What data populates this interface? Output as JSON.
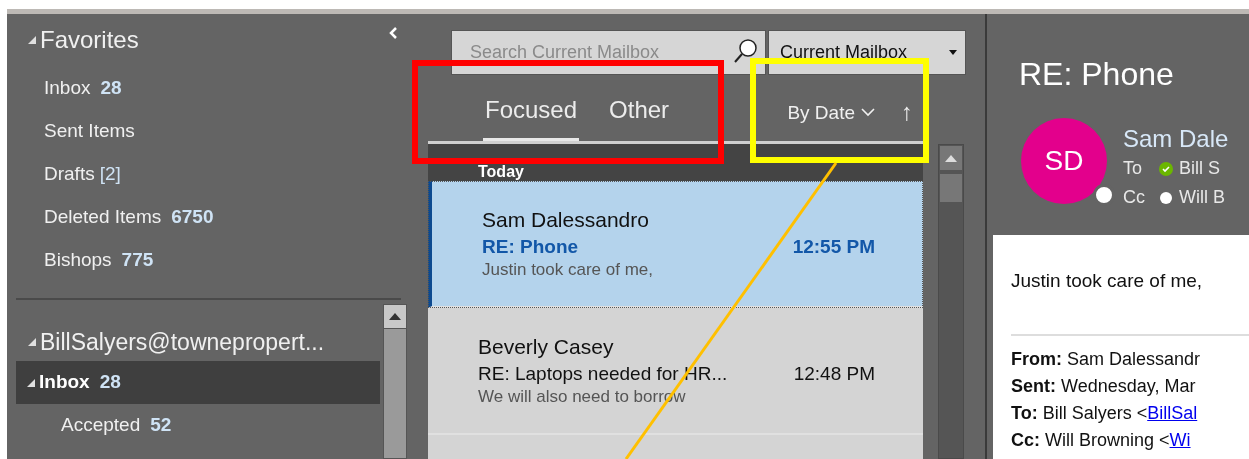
{
  "sidebar": {
    "favorites": {
      "title": "Favorites",
      "expanded": true,
      "items": [
        {
          "label": "Inbox",
          "count": "28",
          "kind": "unread",
          "selected": false
        },
        {
          "label": "Sent Items",
          "kind": "plain",
          "selected": false
        },
        {
          "label": "Drafts",
          "count": "[2]",
          "kind": "draft",
          "selected": false
        },
        {
          "label": "Deleted Items",
          "count": "6750",
          "kind": "unread",
          "selected": false
        },
        {
          "label": "Bishops",
          "count": "775",
          "kind": "unread",
          "selected": false
        }
      ]
    },
    "account": {
      "title": "BillSalyers@townepropert...",
      "expanded": true,
      "folders": [
        {
          "label": "Inbox",
          "count": "28",
          "kind": "unread",
          "selected": true,
          "expanded": true,
          "children": [
            {
              "label": "Accepted",
              "count": "52",
              "kind": "unread",
              "selected": false
            }
          ]
        }
      ]
    }
  },
  "mail_list": {
    "search": {
      "placeholder": "Search Current Mailbox"
    },
    "scope": "Current Mailbox",
    "tabs": [
      {
        "label": "Focused",
        "selected": true
      },
      {
        "label": "Other",
        "selected": false
      }
    ],
    "sort": "By Date",
    "sort_direction": "↑",
    "group": "Today",
    "messages": [
      {
        "sender": "Sam Dalessandro",
        "subject": "RE: Phone",
        "preview": "Justin took care of me,",
        "time": "12:55 PM",
        "selected": true,
        "unread": true
      },
      {
        "sender": "Beverly Casey",
        "subject": "RE: Laptops needed for HR...",
        "preview": "We will also need to borrow",
        "time": "12:48 PM",
        "selected": false,
        "unread": false
      }
    ]
  },
  "reading_pane": {
    "title": "RE: Phone",
    "avatar": {
      "initials": "SD",
      "color": "#e3008c"
    },
    "sender": "Sam Dale",
    "recipients": [
      {
        "label": "To",
        "name": "Bill S",
        "available": true
      },
      {
        "label": "Cc",
        "name": "Will B",
        "available": false
      }
    ],
    "body": "Justin took care of me,",
    "headers": [
      {
        "label": "From:",
        "text": "Sam Dalessandr"
      },
      {
        "label": "Sent:",
        "text": "Wednesday, Mar"
      },
      {
        "label": "To:",
        "text": "Bill Salyers <",
        "link": "BillSal"
      },
      {
        "label": "Cc:",
        "text": "Will Browning <",
        "link": "Wi"
      }
    ]
  },
  "annotations": [
    {
      "kind": "box",
      "color": "#ff0000"
    },
    {
      "kind": "box",
      "color": "#ffff00"
    },
    {
      "kind": "line",
      "color": "#ffc000"
    }
  ]
}
